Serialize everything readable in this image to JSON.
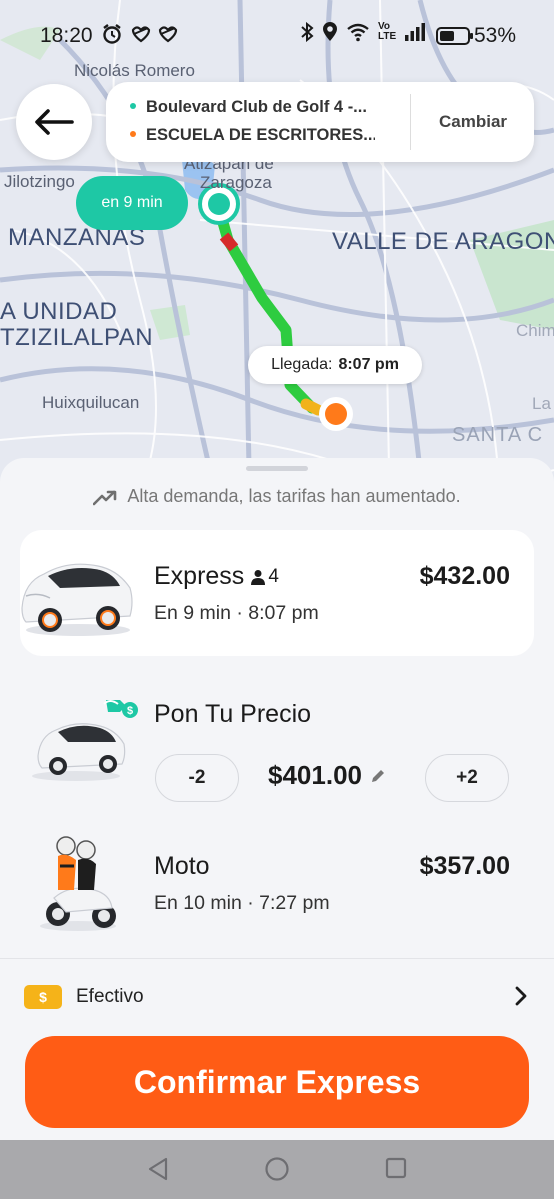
{
  "status_bar": {
    "time": "18:20",
    "left_icons": [
      "alarm-icon",
      "heart-icon",
      "heart-icon"
    ],
    "right_icons": [
      "bluetooth-icon",
      "location-icon",
      "wifi-icon",
      "volte-icon",
      "signal-icon"
    ],
    "volte_top": "Vo",
    "volte_bottom": "LTE",
    "battery_percent": "53%",
    "battery_level": 0.53
  },
  "map": {
    "labels": [
      "Nicolás Romero",
      "Jilotzingo",
      "Atizapán de",
      "Zaragoza",
      "MANZANAS",
      "VALLE DE ARAGON",
      "A UNIDAD",
      "TZIZILALPAN",
      "Huixquilucan",
      "SANTA C",
      "Chim",
      "La",
      "La Magdalena"
    ],
    "eta_pill": "en 9 min",
    "arrival_label": "Llegada:",
    "arrival_time": "8:07 pm",
    "route_color": "#2ecc40",
    "origin_color": "#1ec8a5",
    "destination_color": "#ff7a1a"
  },
  "route": {
    "origin": "Boulevard Club de Golf 4 -...",
    "destination": "ESCUELA DE ESCRITORES...",
    "change_label": "Cambiar"
  },
  "sheet": {
    "demand_notice": "Alta demanda, las tarifas han aumentado.",
    "options": [
      {
        "name": "Express",
        "seats": "4",
        "subtitle": "En 9 min · 8:07 pm",
        "price": "$432.00",
        "selected": true
      },
      {
        "name": "Pon Tu Precio",
        "minus_label": "-2",
        "price": "$401.00",
        "plus_label": "+2"
      },
      {
        "name": "Moto",
        "subtitle": "En 10 min · 7:27 pm",
        "price": "$357.00"
      }
    ],
    "payment": {
      "label": "Efectivo",
      "icon_text": "$"
    },
    "confirm_label": "Confirmar Express"
  },
  "colors": {
    "accent": "#ff5c15",
    "teal": "#1ec8a5",
    "cash": "#f5b319"
  }
}
